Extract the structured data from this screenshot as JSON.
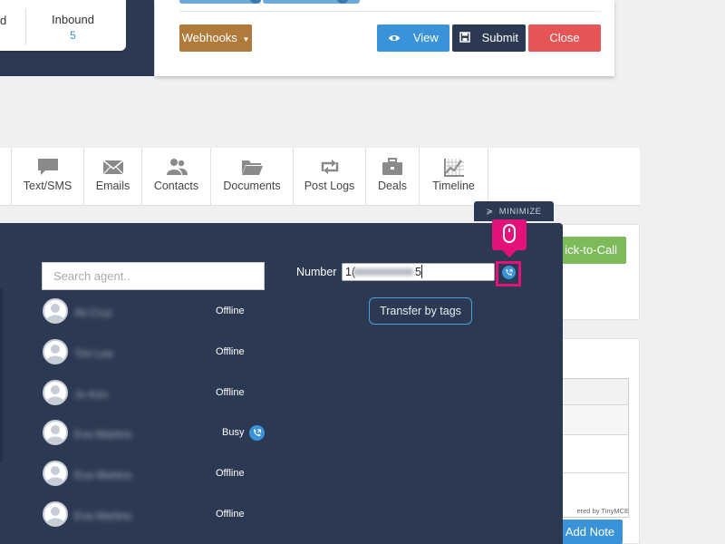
{
  "stats": {
    "cut_label": "d",
    "inbound_label": "Inbound",
    "inbound_value": "5"
  },
  "toolbar": {
    "webhooks_label": "Webhooks",
    "view_label": "View",
    "submit_label": "Submit",
    "close_label": "Close"
  },
  "nav": {
    "items": [
      {
        "label": "Text/SMS",
        "icon": "chat-icon"
      },
      {
        "label": "Emails",
        "icon": "envelope-icon"
      },
      {
        "label": "Contacts",
        "icon": "contacts-icon"
      },
      {
        "label": "Documents",
        "icon": "folder-icon"
      },
      {
        "label": "Post Logs",
        "icon": "retweet-icon"
      },
      {
        "label": "Deals",
        "icon": "briefcase-icon"
      },
      {
        "label": "Timeline",
        "icon": "timeline-chart-icon"
      }
    ]
  },
  "background": {
    "click_to_call_label": "ick-to-Call",
    "powered_text": "ered by TinyMCE",
    "add_note_label": "Add Note"
  },
  "transfer_panel": {
    "minimize_label": "MINIMIZE",
    "search_placeholder": "Search agent..",
    "number_label": "Number",
    "number_prefix": "1(",
    "number_suffix": "5",
    "transfer_by_tags_label": "Transfer by tags",
    "agents": [
      {
        "name": "Ali Cruz",
        "status": "Offline"
      },
      {
        "name": "Tim Lee",
        "status": "Offline"
      },
      {
        "name": "Jo Ken",
        "status": "Offline"
      },
      {
        "name": "Eva Martins",
        "status": "Busy"
      },
      {
        "name": "Eva Martins",
        "status": "Offline"
      },
      {
        "name": "Eva Martins",
        "status": "Offline"
      }
    ]
  },
  "colors": {
    "panel_bg": "#2b3a52",
    "accent_blue": "#3a93d8",
    "highlight": "#e3117a"
  }
}
